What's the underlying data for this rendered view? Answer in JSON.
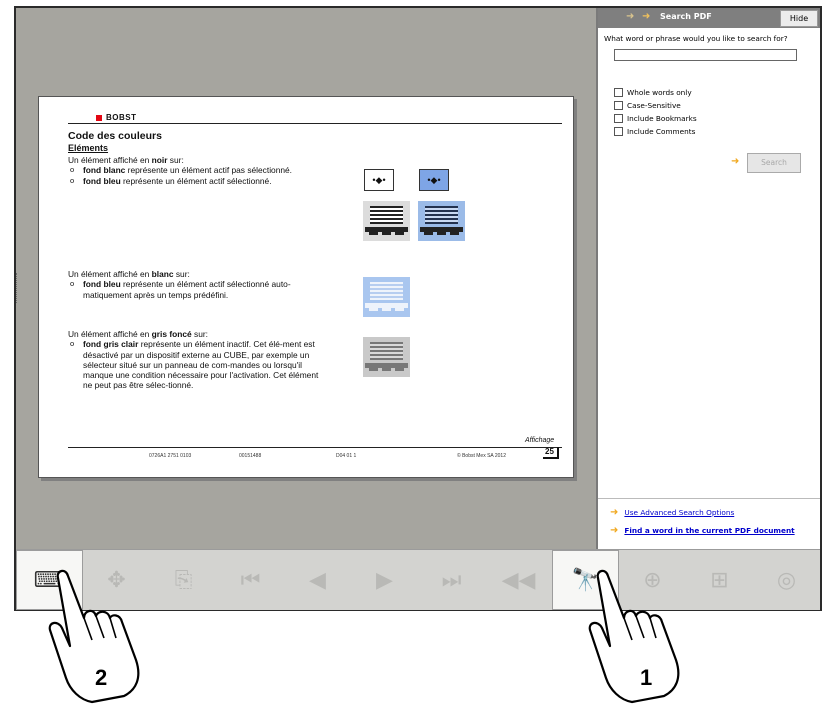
{
  "document": {
    "brand": "BOBST",
    "title": "Code des couleurs",
    "subtitle": "Eléments",
    "para1_intro_a": "Un élément affiché en ",
    "para1_intro_b": "noir",
    "para1_intro_c": " sur:",
    "para1_b1_a": "fond blanc",
    "para1_b1_b": " représente un élément actif pas sélectionné.",
    "para1_b2_a": "fond bleu",
    "para1_b2_b": " représente un élément actif sélectionné.",
    "para2_intro_a": "Un élément affiché en ",
    "para2_intro_b": "blanc",
    "para2_intro_c": " sur:",
    "para2_b1_a": "fond bleu",
    "para2_b1_b": " représente un élément actif sélectionné auto-matiquement après un temps prédéfini.",
    "para3_intro_a": "Un élément affiché en ",
    "para3_intro_b": "gris foncé",
    "para3_intro_c": " sur:",
    "para3_b1_a": "fond gris clair",
    "para3_b1_b": " représente un élément inactif. Cet élé-ment est désactivé par un dispositif externe au CUBE, par exemple un sélecteur situé sur un panneau de com-mandes ou lorsqu'il manque une condition nécessaire pour l'activation. Cet élément ne peut pas être sélec-tionné.",
    "section_label": "Affichage",
    "page_number": "25",
    "footer": [
      "0726A1 2751 0103",
      "00151488",
      "D04 01 1",
      "© Bobst Mex SA 2012"
    ],
    "mini_btn_glyph": "•◆•"
  },
  "search_panel": {
    "title": "Search PDF",
    "hide_label": "Hide",
    "prompt": "What word or phrase would you like to search for?",
    "input_value": "",
    "options": [
      {
        "label": "Whole words only",
        "checked": false
      },
      {
        "label": "Case-Sensitive",
        "checked": false
      },
      {
        "label": "Include Bookmarks",
        "checked": false
      },
      {
        "label": "Include Comments",
        "checked": false
      }
    ],
    "search_label": "Search",
    "link_advanced": "Use Advanced Search Options",
    "link_find": "Find a word in the current PDF document"
  },
  "toolbar": {
    "buttons": [
      {
        "name": "keyboard",
        "glyph": "⌨",
        "state": "active"
      },
      {
        "name": "pan",
        "glyph": "✥",
        "state": "disabled"
      },
      {
        "name": "exit",
        "glyph": "⎘",
        "state": "disabled"
      },
      {
        "name": "first-page",
        "glyph": "⏮",
        "state": "disabled"
      },
      {
        "name": "previous-page",
        "glyph": "◀",
        "state": "disabled"
      },
      {
        "name": "next-page",
        "glyph": "▶",
        "state": "disabled"
      },
      {
        "name": "last-page",
        "glyph": "⏭",
        "state": "disabled"
      },
      {
        "name": "previous-view",
        "glyph": "◀◀",
        "state": "disabled"
      },
      {
        "name": "search",
        "glyph": "🔭",
        "state": "dark"
      },
      {
        "name": "zoom-in",
        "glyph": "⊕",
        "state": "disabled"
      },
      {
        "name": "tree",
        "glyph": "⊞",
        "state": "disabled"
      },
      {
        "name": "web",
        "glyph": "◎",
        "state": "disabled"
      }
    ]
  },
  "callouts": {
    "first": "1",
    "second": "2"
  },
  "colors": {
    "accent_arrow": "#f0a81f",
    "brand_red": "#e30613",
    "selected_blue": "#7ea5e6"
  }
}
